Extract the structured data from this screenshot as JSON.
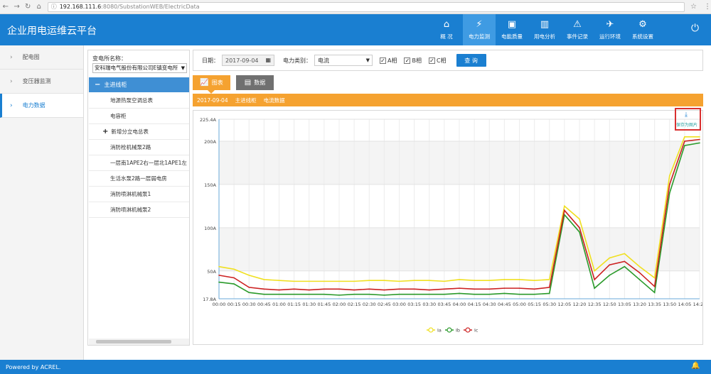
{
  "browser": {
    "url_host": "192.168.111.6",
    "url_path": ":8080/SubstationWEB/ElectricData"
  },
  "app": {
    "title": "企业用电运维云平台",
    "menu": [
      {
        "icon": "home-icon",
        "glyph": "⌂",
        "label": "概 况"
      },
      {
        "icon": "plug-icon",
        "glyph": "⚡",
        "label": "电力监测",
        "active": true
      },
      {
        "icon": "power-quality-icon",
        "glyph": "▣",
        "label": "电能质量"
      },
      {
        "icon": "bar-chart-icon",
        "glyph": "▥",
        "label": "用电分析"
      },
      {
        "icon": "alarm-light-icon",
        "glyph": "⚠",
        "label": "事件记录"
      },
      {
        "icon": "satellite-icon",
        "glyph": "✈",
        "label": "运行环境"
      },
      {
        "icon": "gear-icon",
        "glyph": "⚙",
        "label": "系统设置"
      }
    ]
  },
  "leftnav": {
    "items": [
      {
        "label": "配电图",
        "active": false
      },
      {
        "label": "变压器监测",
        "active": false
      },
      {
        "label": "电力数据",
        "active": true
      }
    ]
  },
  "tree": {
    "label": "变电所名称：",
    "selected_station": "安科瑞电气股份有限公司E镇变电所",
    "root": "主进线柜",
    "nodes": [
      {
        "label": "地源热泵空调总表",
        "plus": false
      },
      {
        "label": "电容柜",
        "plus": false
      },
      {
        "label": "新增分立电总表",
        "plus": true
      },
      {
        "label": "消防栓机械泵2路",
        "plus": false
      },
      {
        "label": "一层南1APE2右一层北1APE1左",
        "plus": false
      },
      {
        "label": "生活水泵2路一层弱电房",
        "plus": false
      },
      {
        "label": "消防喷淋机械泵1",
        "plus": false
      },
      {
        "label": "消防喷淋机械泵2",
        "plus": false
      }
    ]
  },
  "filter": {
    "date_label": "日期：",
    "date_value": "2017-09-04",
    "type_label": "电力类别：",
    "type_value": "电流",
    "phases": [
      "A相",
      "B相",
      "C相"
    ],
    "query_label": "查 询"
  },
  "tabs": {
    "chart": "图表",
    "data": "数据"
  },
  "infobar": {
    "date": "2017-09-04",
    "cabinet": "主进线柜",
    "metric": "电流数据"
  },
  "save_label": "保存为图片",
  "footer": {
    "text": "Powered by ACREL."
  },
  "colors": {
    "ia": "#f0e020",
    "ib": "#2a9a2a",
    "ic": "#cc2020",
    "accent": "#1a7fd1",
    "orange": "#f5a230"
  },
  "chart_data": {
    "type": "line",
    "xlabel": "",
    "ylabel": "",
    "ylim": [
      17.8,
      225.4
    ],
    "yticks": [
      "17.8A",
      "50A",
      "100A",
      "150A",
      "200A",
      "225.4A"
    ],
    "yticks_values": [
      17.8,
      50,
      100,
      150,
      200,
      225.4
    ],
    "x": [
      "00:00",
      "00:15",
      "00:30",
      "00:45",
      "01:00",
      "01:15",
      "01:30",
      "01:45",
      "02:00",
      "02:15",
      "02:30",
      "02:45",
      "03:00",
      "03:15",
      "03:30",
      "03:45",
      "04:00",
      "04:15",
      "04:30",
      "04:45",
      "05:00",
      "05:15",
      "05:30",
      "12:05",
      "12:20",
      "12:35",
      "12:50",
      "13:05",
      "13:20",
      "13:35",
      "13:50",
      "14:05",
      "14:20"
    ],
    "legend_position": "bottom-center",
    "grid": true,
    "series": [
      {
        "name": "Ia",
        "color": "#f0e020",
        "values": [
          55,
          52,
          45,
          40,
          39,
          38,
          38,
          38,
          38,
          38,
          39,
          39,
          38,
          39,
          39,
          38,
          40,
          39,
          39,
          40,
          40,
          39,
          40,
          125,
          110,
          50,
          65,
          70,
          55,
          42,
          160,
          205,
          205
        ]
      },
      {
        "name": "Ib",
        "color": "#2a9a2a",
        "values": [
          37,
          35,
          25,
          23,
          23,
          23,
          23,
          23,
          22,
          23,
          23,
          22,
          23,
          23,
          23,
          23,
          24,
          23,
          23,
          24,
          23,
          23,
          24,
          115,
          95,
          30,
          45,
          55,
          40,
          25,
          140,
          195,
          198
        ]
      },
      {
        "name": "Ic",
        "color": "#cc2020",
        "values": [
          45,
          42,
          31,
          29,
          28,
          29,
          28,
          29,
          29,
          28,
          29,
          28,
          29,
          29,
          28,
          29,
          30,
          29,
          29,
          30,
          30,
          29,
          31,
          120,
          100,
          40,
          57,
          61,
          48,
          32,
          150,
          200,
          202
        ]
      }
    ]
  }
}
